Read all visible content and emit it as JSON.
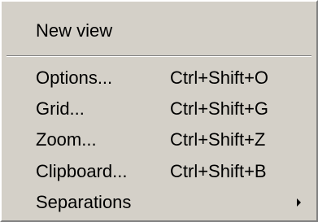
{
  "menu": {
    "top_item": {
      "label": "New view"
    },
    "items": [
      {
        "label": "Options...",
        "shortcut": "Ctrl+Shift+O"
      },
      {
        "label": "Grid...",
        "shortcut": "Ctrl+Shift+G"
      },
      {
        "label": "Zoom...",
        "shortcut": "Ctrl+Shift+Z"
      },
      {
        "label": "Clipboard...",
        "shortcut": "Ctrl+Shift+B"
      },
      {
        "label": "Separations",
        "submenu_icon": "submenu-arrow-icon"
      }
    ]
  },
  "colors": {
    "menu_background": "#d4d0c8",
    "text": "#000000",
    "highlight": "#ffffff",
    "shadow": "#808080"
  }
}
